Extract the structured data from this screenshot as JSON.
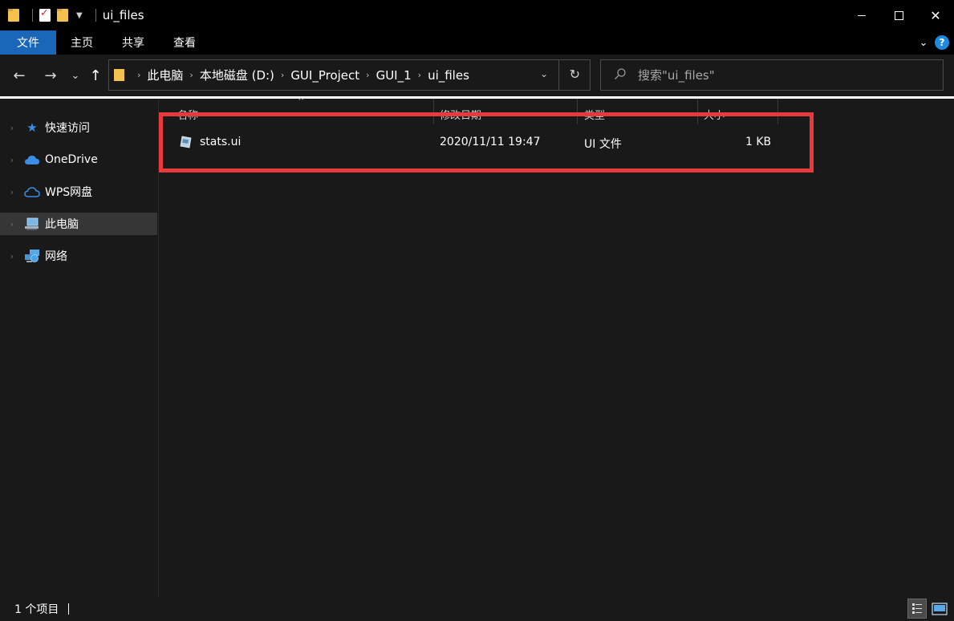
{
  "window": {
    "title": "ui_files",
    "minimize_glyph": "",
    "maximize_glyph": "",
    "close_glyph": "✕"
  },
  "ribbon": {
    "tabs": [
      "文件",
      "主页",
      "共享",
      "查看"
    ],
    "active_tab": "文件",
    "accent_color": "#1a66b8"
  },
  "navigation": {
    "back": "←",
    "forward": "→",
    "recent": "⌄",
    "up": "↑",
    "breadcrumbs": [
      "此电脑",
      "本地磁盘 (D:)",
      "GUI_Project",
      "GUI_1",
      "ui_files"
    ],
    "breadcrumb_separator": "›",
    "address_dropdown": "⌄",
    "refresh": "↻"
  },
  "search": {
    "placeholder": "搜索\"ui_files\"",
    "icon": "search-icon"
  },
  "sidebar": {
    "items": [
      {
        "label": "快速访问",
        "icon": "star-icon",
        "color": "#3a8ee6"
      },
      {
        "label": "OneDrive",
        "icon": "cloud-icon",
        "color": "#3a8ee6"
      },
      {
        "label": "WPS网盘",
        "icon": "cloud-outline-icon",
        "color": "#3a8ee6"
      },
      {
        "label": "此电脑",
        "icon": "computer-icon",
        "color": "#7ab8e8",
        "selected": true
      },
      {
        "label": "网络",
        "icon": "network-icon",
        "color": "#5aa8e8"
      }
    ]
  },
  "columns": [
    "名称",
    "修改日期",
    "类型",
    "大小"
  ],
  "files": [
    {
      "name": "stats.ui",
      "modified": "2020/11/11 19:47",
      "type": "UI 文件",
      "size": "1 KB"
    }
  ],
  "status": {
    "count_text": "1 个项目"
  },
  "highlight_color": "#e8393c"
}
